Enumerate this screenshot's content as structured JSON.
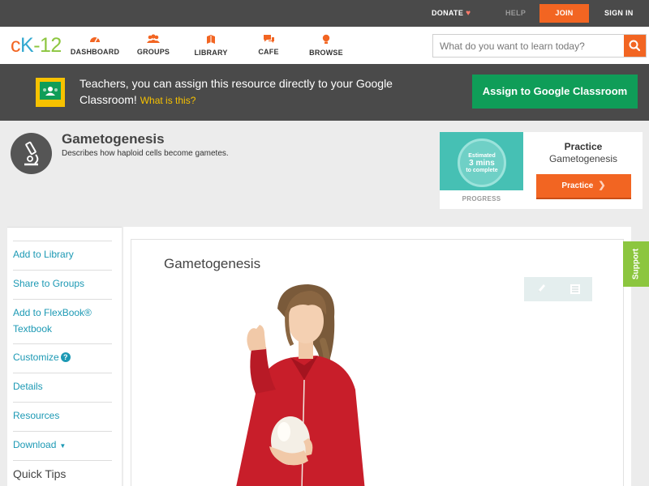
{
  "top_bar": {
    "donate": "DONATE",
    "help": "HELP",
    "join": "JOIN",
    "sign_in": "SIGN IN"
  },
  "nav": {
    "logo": {
      "c": "c",
      "k": "K",
      "n": "-12"
    },
    "items": [
      {
        "label": "DASHBOARD",
        "icon": "dashboard-icon"
      },
      {
        "label": "GROUPS",
        "icon": "groups-icon"
      },
      {
        "label": "LIBRARY",
        "icon": "library-icon"
      },
      {
        "label": "CAFE",
        "icon": "cafe-icon"
      },
      {
        "label": "BROWSE",
        "icon": "browse-icon"
      }
    ],
    "search_placeholder": "What do you want to learn today?"
  },
  "classroom_banner": {
    "text": "Teachers, you can assign this resource directly to your Google Classroom!",
    "what_is_this": "What is this?",
    "assign_button": "Assign to Google Classroom"
  },
  "concept": {
    "title": "Gametogenesis",
    "description": "Describes how haploid cells become gametes."
  },
  "practice_card": {
    "estimate_line1": "Estimated",
    "estimate_line2": "3 mins",
    "estimate_line3": "to complete",
    "progress_label": "PROGRESS",
    "heading": "Practice",
    "subtitle": "Gametogenesis",
    "button": "Practice"
  },
  "sidebar": {
    "items": [
      {
        "label": "Add to Library"
      },
      {
        "label": "Share to Groups"
      },
      {
        "label": "Add to FlexBook® Textbook"
      },
      {
        "label": "Customize"
      },
      {
        "label": "Details"
      },
      {
        "label": "Resources"
      },
      {
        "label": "Download"
      }
    ],
    "quick_tips": "Quick Tips"
  },
  "content": {
    "title": "Gametogenesis"
  },
  "support": "Support",
  "colors": {
    "brand_orange": "#f26522",
    "brand_teal": "#1c99b4",
    "brand_green": "#8cc63f",
    "classroom_green": "#0f9d58",
    "dark_bar": "#4a4a4a"
  }
}
